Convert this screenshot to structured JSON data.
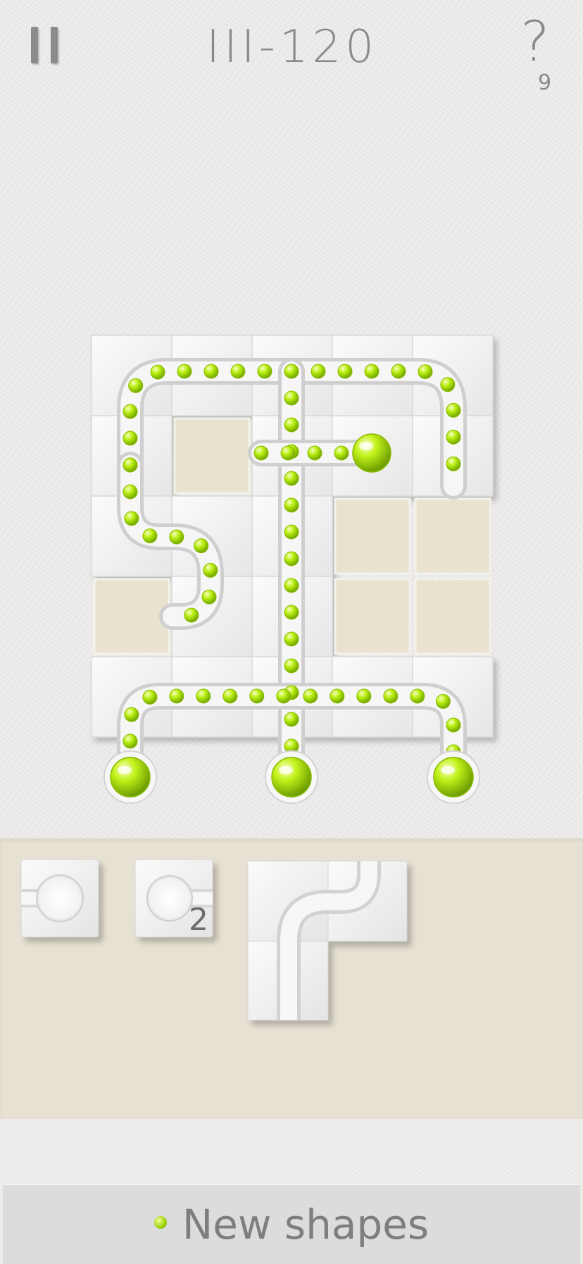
{
  "header": {
    "level": "III-120",
    "help_symbol": "?",
    "hints_left": "9"
  },
  "tray": {
    "piece_count": "2"
  },
  "footer": {
    "new_shapes_label": "New shapes"
  },
  "colors": {
    "accent_green": "#a4e000",
    "tray_bg": "#e6e1d2"
  },
  "icons": [
    "pause-icon",
    "help-icon",
    "green-dot-icon"
  ]
}
